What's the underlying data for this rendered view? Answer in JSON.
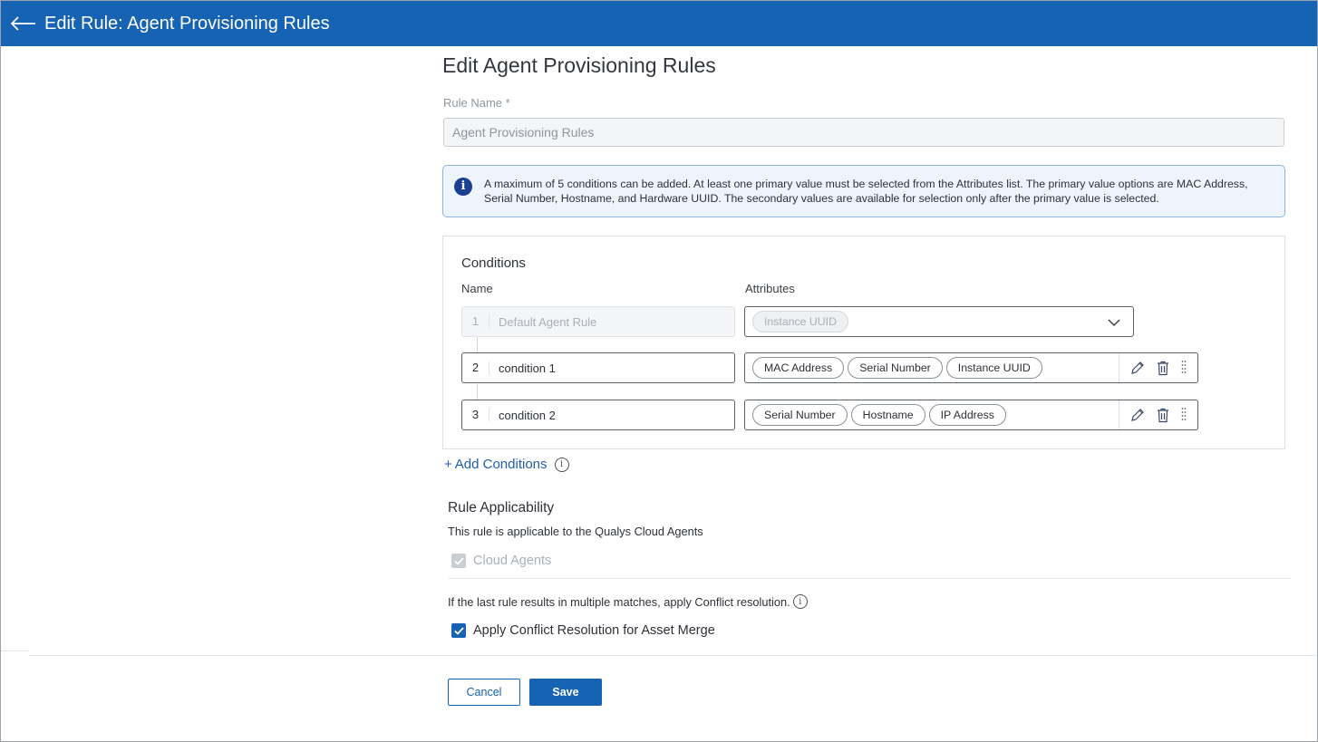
{
  "header": {
    "title": "Edit Rule: Agent Provisioning Rules"
  },
  "form": {
    "heading": "Edit Agent Provisioning Rules",
    "rule_name_label": "Rule Name *",
    "rule_name_value": "Agent Provisioning Rules"
  },
  "info": {
    "text": "A maximum of 5 conditions can be added. At least one primary value must be selected from the Attributes list. The primary value options are MAC Address, Serial Number, Hostname, and Hardware UUID. The secondary values are available for selection only after the primary value is selected."
  },
  "conditions": {
    "title": "Conditions",
    "col_name": "Name",
    "col_attributes": "Attributes",
    "rows": [
      {
        "num": "1",
        "name": "Default Agent Rule",
        "attributes": [
          "Instance UUID"
        ]
      },
      {
        "num": "2",
        "name": "condition 1",
        "attributes": [
          "MAC Address",
          "Serial Number",
          "Instance UUID"
        ]
      },
      {
        "num": "3",
        "name": "condition 2",
        "attributes": [
          "Serial Number",
          "Hostname",
          "IP Address"
        ]
      }
    ],
    "add_label": "Add Conditions"
  },
  "applicability": {
    "title": "Rule Applicability",
    "description": "This rule is applicable to the Qualys Cloud Agents",
    "cloud_agents_label": "Cloud Agents",
    "cloud_agents_checked": true,
    "conflict_text": "If the last rule results in multiple matches, apply Conflict resolution.",
    "conflict_label": "Apply Conflict Resolution for Asset Merge",
    "conflict_checked": true
  },
  "actions": {
    "cancel": "Cancel",
    "save": "Save"
  },
  "colors": {
    "primary": "#1763b3",
    "info_bg": "#eef4fb",
    "info_icon": "#1d3f91"
  }
}
